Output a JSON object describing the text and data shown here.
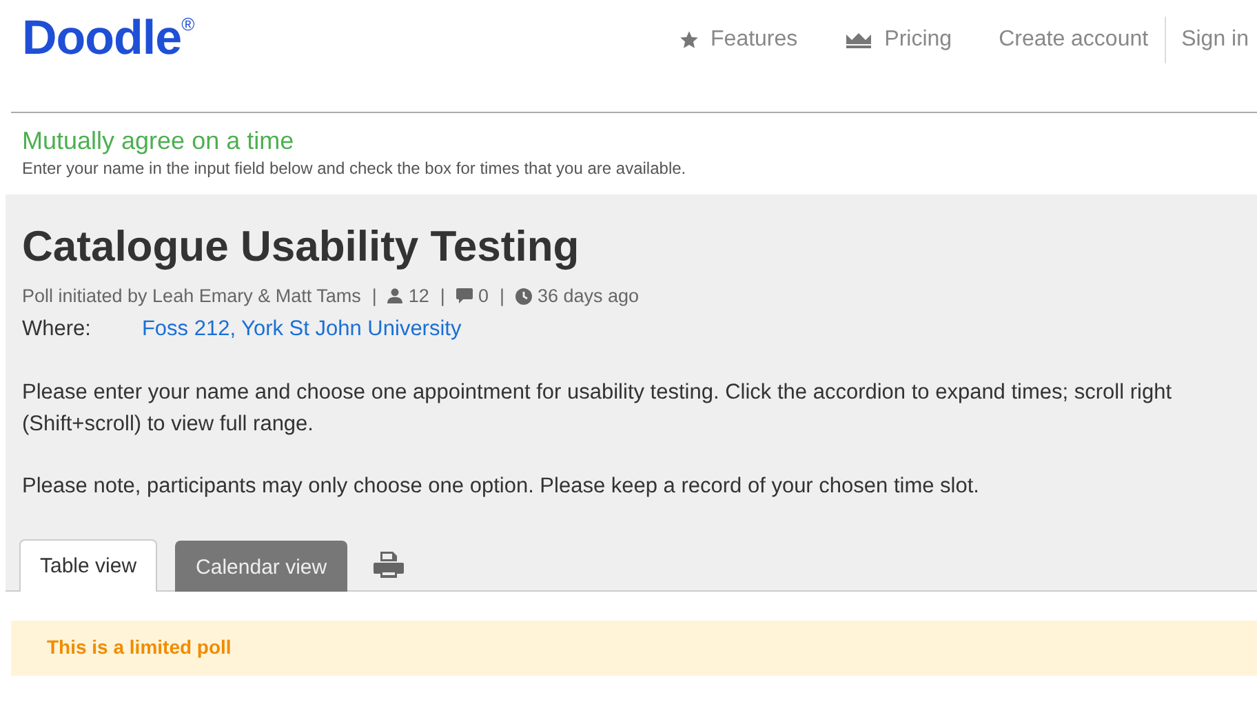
{
  "header": {
    "logo": "Doodle",
    "registered_mark": "®",
    "nav": [
      {
        "kind": "star",
        "label": "Features"
      },
      {
        "kind": "crown",
        "label": "Pricing"
      },
      {
        "kind": "plain",
        "label": "Create account"
      },
      {
        "kind": "divided",
        "label": "Sign in"
      }
    ]
  },
  "intro": {
    "heading": "Mutually agree on a time",
    "text": "Enter your name in the input field below and check the box for times that you are available."
  },
  "poll": {
    "title": "Catalogue Usability Testing",
    "initiator": "Poll initiated by Leah Emary & Matt Tams",
    "separator": "|",
    "participants": "12",
    "comments": "0",
    "age": "36 days ago",
    "where_label": "Where:",
    "where_value": "Foss 212, York St John University",
    "paragraphs": [
      "Please enter your name and choose one appointment for usability testing. Click the accordion to expand times; scroll right (Shift+scroll) to view full range.",
      "Please note, participants may only choose one option. Please keep a record of your chosen time slot."
    ]
  },
  "tabs": [
    {
      "label": "Table view",
      "selected": true
    },
    {
      "label": "Calendar view",
      "selected": false
    }
  ],
  "notice": {
    "title": "This is a limited poll"
  }
}
